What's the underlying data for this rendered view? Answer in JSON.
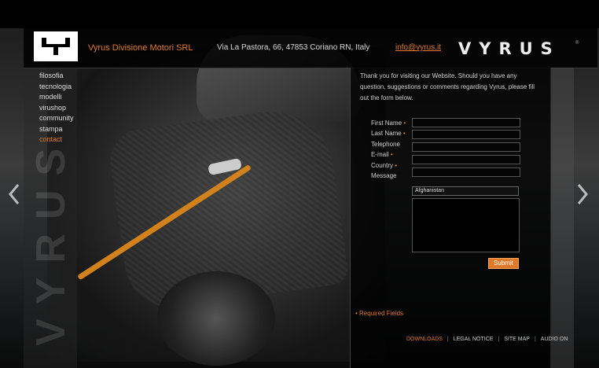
{
  "header": {
    "company": "Vyrus Divisione Motori SRL",
    "address": "Via La Pastora, 66, 47853 Coriano RN, Italy",
    "email": "info@vyrus.it",
    "wordmark": "VYRUS",
    "reg_mark": "®"
  },
  "brand_vertical": "VYRUS",
  "nav": {
    "items": [
      {
        "label": "filosofia"
      },
      {
        "label": "tecnologia"
      },
      {
        "label": "modelli"
      },
      {
        "label": "virushop"
      },
      {
        "label": "community"
      },
      {
        "label": "stampa"
      },
      {
        "label": "contact",
        "active": true
      }
    ]
  },
  "form": {
    "intro": "Thank you for visiting our Website. Should you have any question, suggestions or comments regarding Vyrus, please fill out the form below.",
    "fields": [
      {
        "label": "First Name",
        "required": true
      },
      {
        "label": "Last Name",
        "required": true
      },
      {
        "label": "Telephone",
        "required": false
      },
      {
        "label": "E-mail",
        "required": true
      },
      {
        "label": "Country",
        "required": true
      },
      {
        "label": "Message",
        "required": false
      }
    ],
    "required_marker": "•",
    "country_selected": "Afghanistan",
    "submit_label": "Submit",
    "required_note": "• Required Fields"
  },
  "footer": {
    "links": [
      {
        "label": "DOWNLOADS",
        "highlight": true
      },
      {
        "label": "LEGAL NOTICE"
      },
      {
        "label": "SITE MAP"
      },
      {
        "label": "AUDIO ON"
      }
    ],
    "separator": "|"
  },
  "colors": {
    "accent": "#e07a28",
    "text": "#cfcfcf"
  },
  "icons": [
    "left-arrow-icon",
    "right-arrow-icon",
    "vyrus-logo-icon"
  ]
}
